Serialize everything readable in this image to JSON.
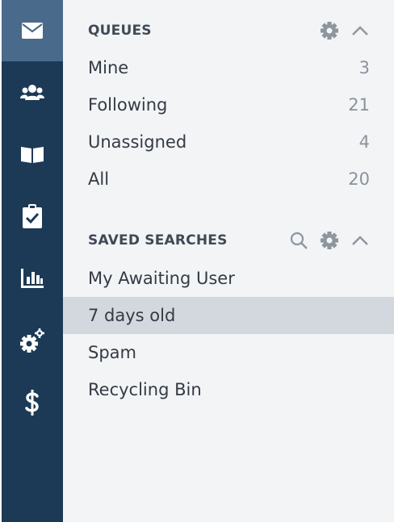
{
  "nav": {
    "items": [
      {
        "icon": "envelope-icon",
        "active": true
      },
      {
        "icon": "users-icon",
        "active": false
      },
      {
        "icon": "book-icon",
        "active": false
      },
      {
        "icon": "clipboard-check-icon",
        "active": false
      },
      {
        "icon": "chart-icon",
        "active": false
      },
      {
        "icon": "gears-icon",
        "active": false
      },
      {
        "icon": "dollar-icon",
        "active": false
      }
    ]
  },
  "queues": {
    "title": "QUEUES",
    "items": [
      {
        "label": "Mine",
        "count": "3"
      },
      {
        "label": "Following",
        "count": "21"
      },
      {
        "label": "Unassigned",
        "count": "4"
      },
      {
        "label": "All",
        "count": "20"
      }
    ]
  },
  "saved_searches": {
    "title": "SAVED SEARCHES",
    "selected": "7 days old",
    "items": [
      {
        "label": "My Awaiting User"
      },
      {
        "label": "7 days old"
      },
      {
        "label": "Spam"
      },
      {
        "label": "Recycling Bin"
      }
    ]
  },
  "colors": {
    "rail_background": "#1c3a55",
    "rail_active": "#4a6a8c",
    "panel_background": "#f3f4f6",
    "selected_row": "#d3d8de"
  }
}
